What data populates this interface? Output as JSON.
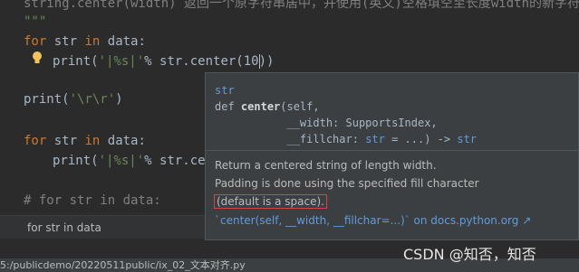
{
  "editor": {
    "line1": "string.center(width) 返回一个原字符串居中，并使用(英文)空格填空至长度width的新字符串",
    "line2": "\"\"\"",
    "line3_kw": "for",
    "line3_var": "str",
    "line3_kw2": "in",
    "line3_rest": "data:",
    "line4_print": "print(",
    "line4_str": "'|%s|'",
    "line4_rest": "% str.center(10))",
    "line6_print": "print(",
    "line6_str": "'\\r\\r'",
    "line6_rest": ")",
    "line8_kw": "for",
    "line8_var": "str",
    "line8_kw2": "in",
    "line8_rest": "data:",
    "line9_print": "print(",
    "line9_str": "'|%s|'",
    "line9_rest": "% str.cen",
    "line11": "# for str in data:"
  },
  "popup": {
    "module": "str",
    "def_kw": "def",
    "func_name": "center",
    "param1": "(self,",
    "param2": "__width: SupportsIndex,",
    "param3_a": "__fillchar: ",
    "param3_str": "str",
    "param3_b": " = ...) -> ",
    "param3_ret": "str",
    "desc1": "Return a centered string of length width.",
    "desc2": "Padding is done using the specified fill character",
    "desc3": "(default is a space).",
    "doc_link": "`center(self, __width, __fillchar=...)` on docs.python.org ↗"
  },
  "breadcrumb": {
    "text": "for str in data"
  },
  "status": {
    "path": "5:/publicdemo/20220511public/ix_02_文本对齐.py"
  },
  "watermark": "CSDN @知否，知否"
}
